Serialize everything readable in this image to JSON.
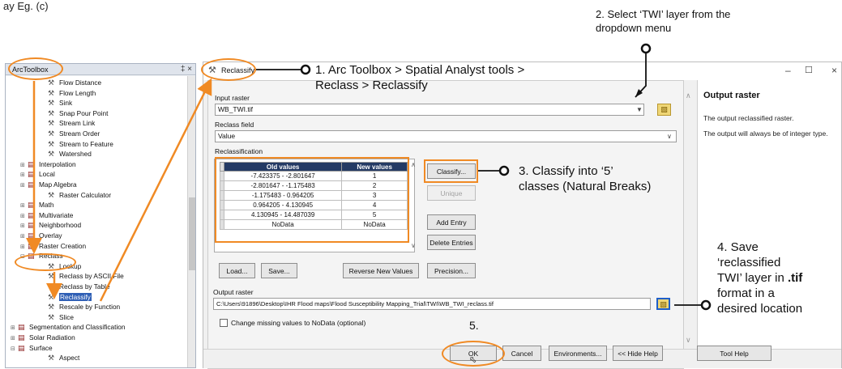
{
  "caption": "ay Eg. (c)",
  "toolbox": {
    "title": "ArcToolbox",
    "pin": "‡ ×",
    "items": [
      {
        "label": "Flow Distance",
        "level": 3,
        "type": "tool"
      },
      {
        "label": "Flow Length",
        "level": 3,
        "type": "tool"
      },
      {
        "label": "Sink",
        "level": 3,
        "type": "tool"
      },
      {
        "label": "Snap Pour Point",
        "level": 3,
        "type": "tool"
      },
      {
        "label": "Stream Link",
        "level": 3,
        "type": "tool"
      },
      {
        "label": "Stream Order",
        "level": 3,
        "type": "tool"
      },
      {
        "label": "Stream to Feature",
        "level": 3,
        "type": "tool"
      },
      {
        "label": "Watershed",
        "level": 3,
        "type": "tool"
      },
      {
        "label": "Interpolation",
        "level": 2,
        "type": "toolset"
      },
      {
        "label": "Local",
        "level": 2,
        "type": "toolset"
      },
      {
        "label": "Map Algebra",
        "level": 2,
        "type": "toolset"
      },
      {
        "label": "Raster Calculator",
        "level": 3,
        "type": "tool"
      },
      {
        "label": "Math",
        "level": 2,
        "type": "toolset"
      },
      {
        "label": "Multivariate",
        "level": 2,
        "type": "toolset"
      },
      {
        "label": "Neighborhood",
        "level": 2,
        "type": "toolset"
      },
      {
        "label": "Overlay",
        "level": 2,
        "type": "toolset"
      },
      {
        "label": "Raster Creation",
        "level": 2,
        "type": "toolset"
      },
      {
        "label": "Reclass",
        "level": 2,
        "type": "toolset"
      },
      {
        "label": "Lookup",
        "level": 3,
        "type": "tool"
      },
      {
        "label": "Reclass by ASCII File",
        "level": 3,
        "type": "tool"
      },
      {
        "label": "Reclass by Table",
        "level": 3,
        "type": "tool"
      },
      {
        "label": "Reclassify",
        "level": 3,
        "type": "tool",
        "selected": true
      },
      {
        "label": "Rescale by Function",
        "level": 3,
        "type": "tool"
      },
      {
        "label": "Slice",
        "level": 3,
        "type": "tool"
      },
      {
        "label": "Segmentation and Classification",
        "level": 1,
        "type": "toolset"
      },
      {
        "label": "Solar Radiation",
        "level": 1,
        "type": "toolset"
      },
      {
        "label": "Surface",
        "level": 1,
        "type": "toolset"
      },
      {
        "label": "Aspect",
        "level": 3,
        "type": "tool"
      }
    ]
  },
  "dialog": {
    "title": "Reclassify",
    "window_controls": {
      "minimize": "–",
      "maximize": "☐",
      "close": "×"
    },
    "input_raster": {
      "label": "Input raster",
      "value": "WB_TWI.tif"
    },
    "reclass_field": {
      "label": "Reclass field",
      "value": "Value"
    },
    "reclassification": {
      "label": "Reclassification",
      "columns": [
        "Old values",
        "New values"
      ],
      "rows": [
        [
          "-7.423375 - -2.801647",
          "1"
        ],
        [
          "-2.801647 - -1.175483",
          "2"
        ],
        [
          "-1.175483 - 0.964205",
          "3"
        ],
        [
          "0.964205 - 4.130945",
          "4"
        ],
        [
          "4.130945 - 14.487039",
          "5"
        ],
        [
          "NoData",
          "NoData"
        ]
      ]
    },
    "side_buttons": {
      "classify": "Classify...",
      "unique": "Unique",
      "add_entry": "Add Entry",
      "delete_entries": "Delete Entries"
    },
    "table_buttons": {
      "load": "Load...",
      "save": "Save...",
      "reverse": "Reverse New Values",
      "precision": "Precision..."
    },
    "output_raster": {
      "label": "Output raster",
      "value": "C:\\Users\\91896\\Desktop\\IHR Flood maps\\Flood Susceptibility Mapping_Trial\\TWI\\WB_TWI_reclass.tif"
    },
    "nodata_checkbox": {
      "label": "Change missing values to NoData (optional)",
      "checked": false
    },
    "bottom_buttons": {
      "ok": "OK",
      "cancel": "Cancel",
      "environments": "Environments...",
      "hide_help": "<< Hide Help",
      "tool_help": "Tool Help"
    },
    "help": {
      "title": "Output raster",
      "text1": "The output reclassified raster.",
      "text2": "The output will always be of integer type."
    }
  },
  "annotations": {
    "step1_line1": "1. Arc Toolbox > Spatial Analyst tools >",
    "step1_line2": "Reclass > Reclassify",
    "step2_line1": "2. Select ‘TWI’ layer from the",
    "step2_line2": "dropdown menu",
    "step3_line1": "3. Classify into ‘5’",
    "step3_line2": "classes (Natural Breaks)",
    "step4_line1": "4. Save",
    "step4_line2": "‘reclassified",
    "step4_line3a": "TWI’ layer in ",
    "step4_line3b": ".tif",
    "step4_line4": "format in a",
    "step4_line5": "desired location",
    "step5": "5.",
    "accent_color": "#f08a24"
  }
}
